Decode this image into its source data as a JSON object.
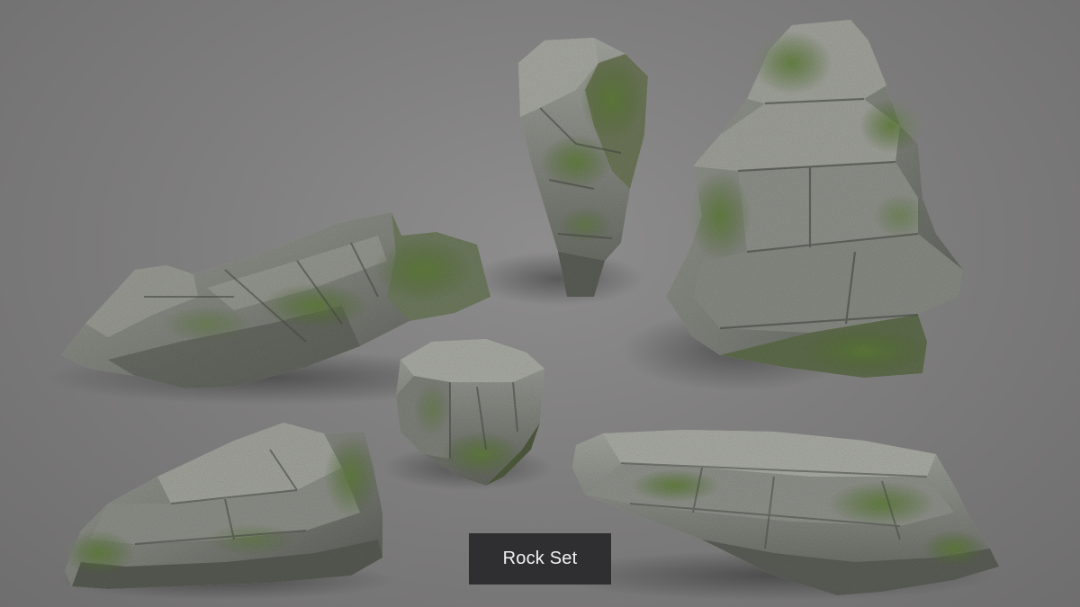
{
  "caption": {
    "label": "Rock Set"
  },
  "colors": {
    "background": "#7f7e7e",
    "rock_stone": "#8a8d86",
    "rock_dark": "#4f534c",
    "moss": "#5e7a3a",
    "caption_bg": "#2f2f31",
    "caption_text": "#f2f2f2"
  },
  "rocks": [
    {
      "name": "flat-slab-rock-left"
    },
    {
      "name": "tall-pillar-rock"
    },
    {
      "name": "large-stacked-boulder"
    },
    {
      "name": "small-cube-rock"
    },
    {
      "name": "low-rock-bottom-left"
    },
    {
      "name": "long-flat-rock-bottom-right"
    }
  ]
}
